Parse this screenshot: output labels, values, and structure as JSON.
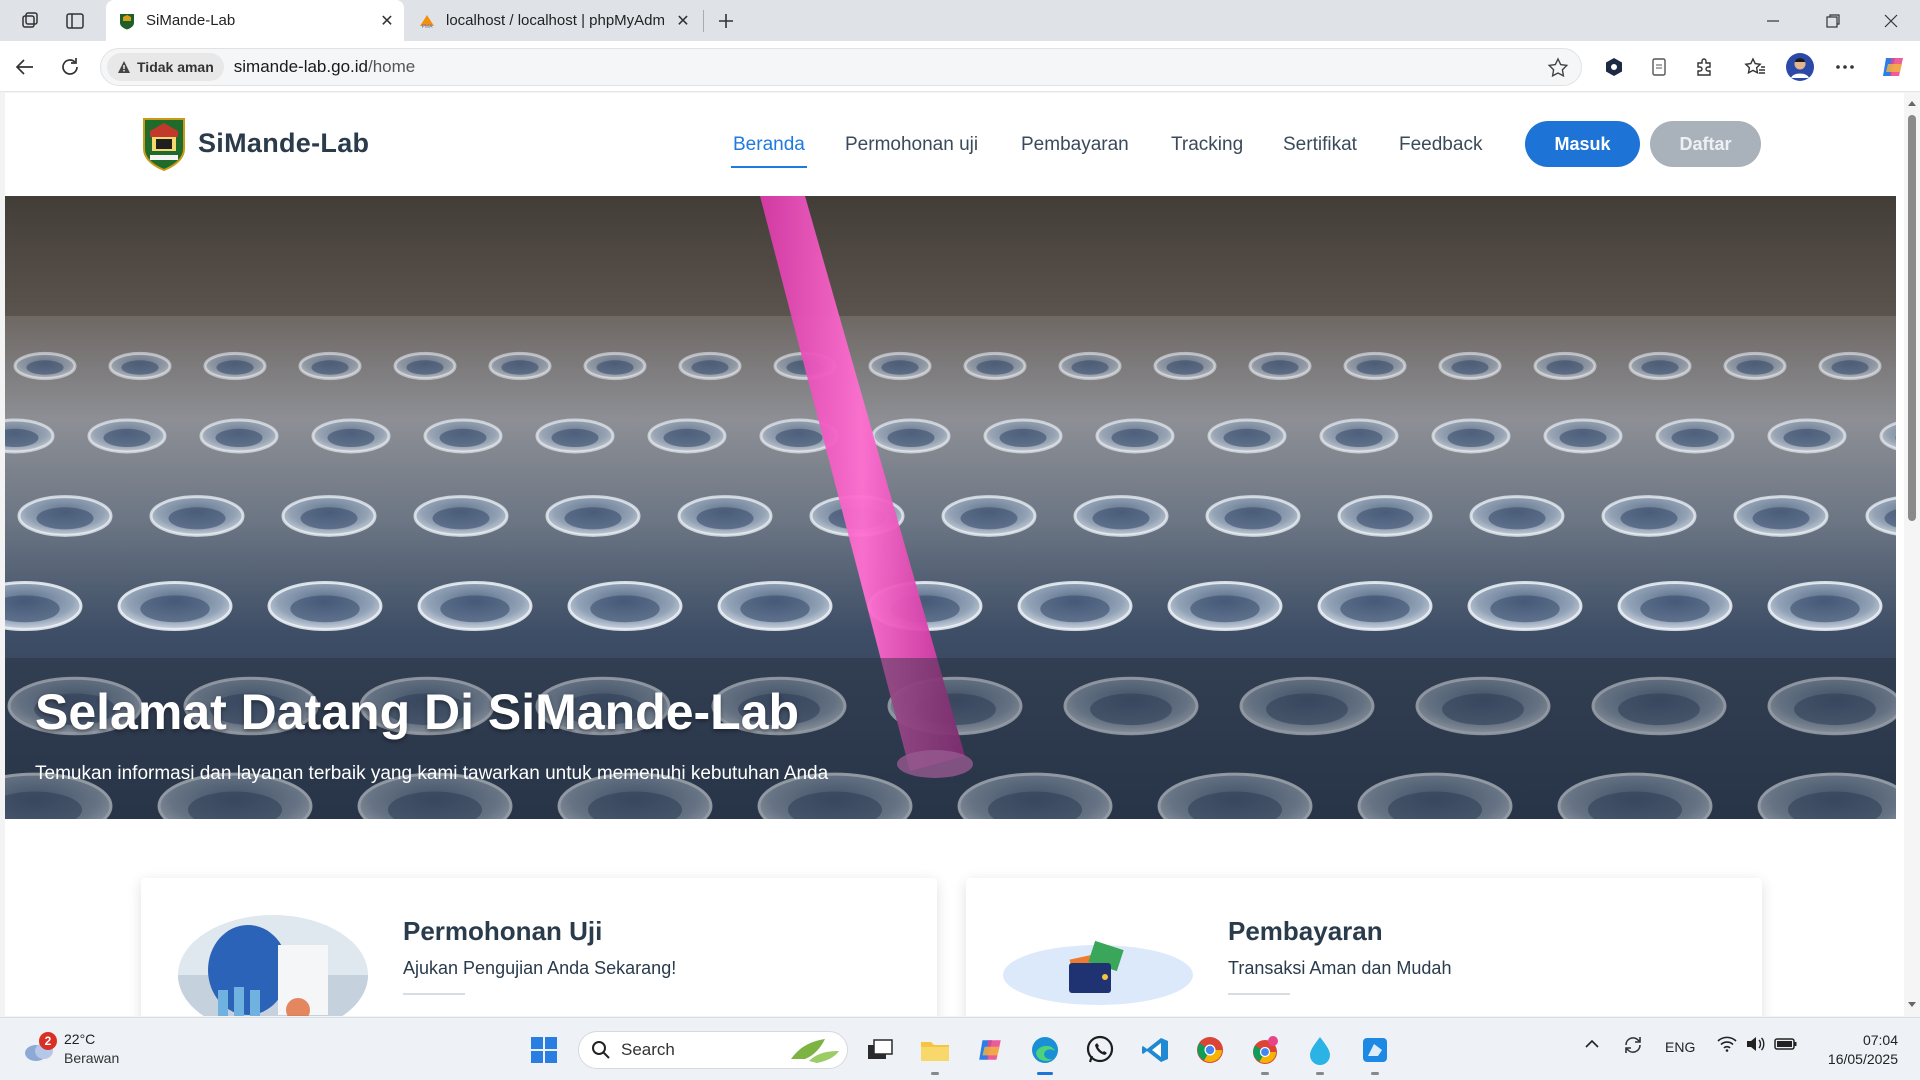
{
  "browser": {
    "tabs": [
      {
        "title": "SiMande-Lab",
        "active": true
      },
      {
        "title": "localhost / localhost | phpMyAdm",
        "active": false
      }
    ],
    "security_label": "Tidak aman",
    "url_host": "simande-lab.go.id",
    "url_path": "/home"
  },
  "site": {
    "brand_name": "SiMande-Lab",
    "nav": [
      "Beranda",
      "Permohonan uji",
      "Pembayaran",
      "Tracking",
      "Sertifikat",
      "Feedback"
    ],
    "active_nav": "Beranda",
    "login_label": "Masuk",
    "register_label": "Daftar",
    "hero": {
      "title": "Selamat Datang Di SiMande-Lab",
      "subtitle": "Temukan informasi dan layanan terbaik yang kami tawarkan untuk memenuhi kebutuhan Anda"
    },
    "cards": [
      {
        "title": "Permohonan Uji",
        "subtitle": "Ajukan Pengujian Anda Sekarang!"
      },
      {
        "title": "Pembayaran",
        "subtitle": "Transaksi Aman dan Mudah"
      }
    ]
  },
  "taskbar": {
    "weather_temp": "22°C",
    "weather_condition": "Berawan",
    "weather_badge": "2",
    "search_placeholder": "Search",
    "language": "ENG",
    "time": "07:04",
    "date": "16/05/2025"
  },
  "colors": {
    "accent": "#1e74d6",
    "heading": "#2a3b4c",
    "muted_button": "#a9b2bb"
  }
}
